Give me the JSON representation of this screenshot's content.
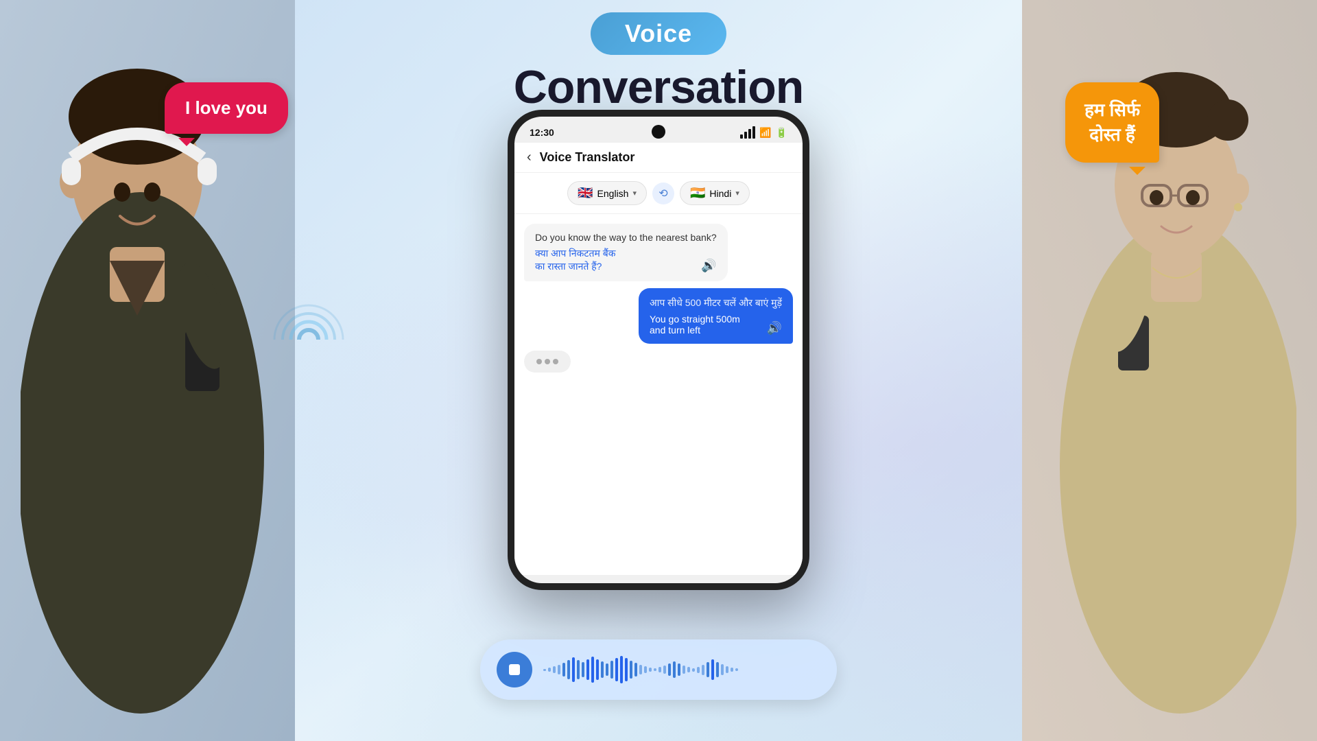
{
  "title": {
    "voice_badge": "Voice",
    "conversation": "Conversation"
  },
  "bubble_left": {
    "text": "I love you"
  },
  "bubble_right": {
    "line1": "हम सिर्फ",
    "line2": "दोस्त हैं"
  },
  "phone": {
    "status_bar": {
      "time": "12:30"
    },
    "header_title": "Voice Translator",
    "back_label": "‹",
    "lang_from": "English",
    "lang_to": "Hindi",
    "lang_from_flag": "🇬🇧",
    "lang_to_flag": "🇮🇳",
    "swap_icon": "⟳",
    "messages": [
      {
        "side": "left",
        "original": "Do you know the way to the nearest bank?",
        "translated": "क्या आप निकटतम बैंक का रास्ता जानते हैं?"
      },
      {
        "side": "right",
        "original": "आप सीधे 500 मीटर चलें और बाएं मुड़ें",
        "translated": "You go straight 500m and turn left"
      }
    ]
  },
  "audio_bar": {
    "stop_label": "stop",
    "wave_bars": [
      3,
      6,
      10,
      14,
      20,
      28,
      36,
      28,
      22,
      30,
      38,
      30,
      24,
      18,
      26,
      34,
      40,
      34,
      26,
      20,
      14,
      10,
      6,
      4,
      8,
      12,
      18,
      24,
      18,
      12,
      8,
      5,
      9,
      15,
      22,
      30,
      22,
      16,
      10,
      6,
      4
    ]
  },
  "colors": {
    "accent_blue": "#2563eb",
    "bubble_left_bg": "#e0184e",
    "bubble_right_bg": "#f5960a",
    "voice_badge_bg": "#4a9fd4",
    "audio_bar_bg": "rgba(210,230,255,0.92)"
  }
}
